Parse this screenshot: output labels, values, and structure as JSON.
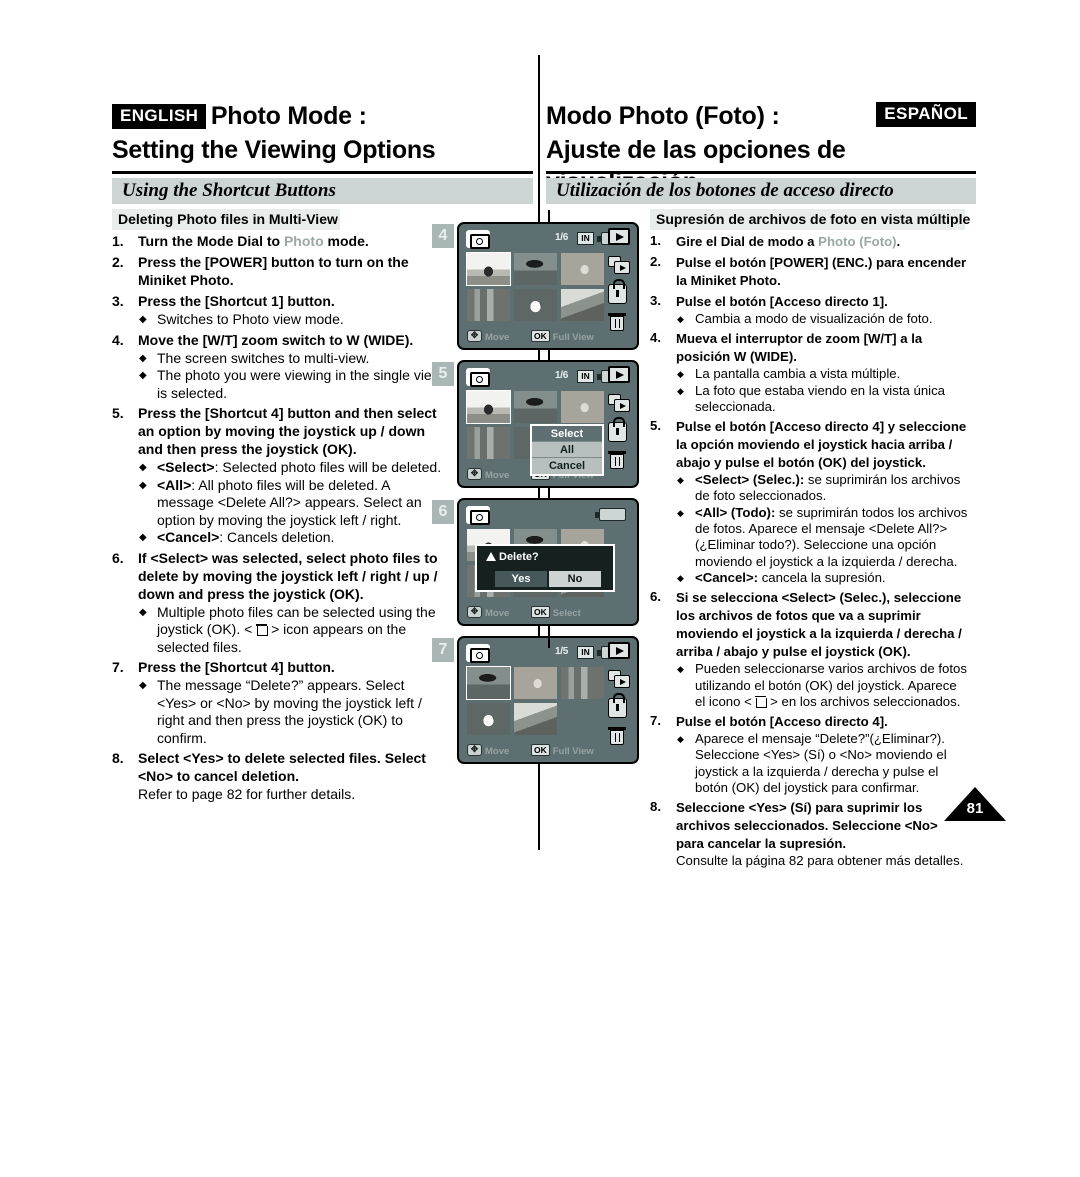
{
  "page": {
    "number": "81"
  },
  "header": {
    "english": {
      "lang_tag": "ENGLISH",
      "title_line1": "Photo Mode :",
      "title_line2": "Setting the Viewing Options",
      "banner": "Using the Shortcut Buttons",
      "subbanner": "Deleting Photo files in Multi-View"
    },
    "spanish": {
      "lang_tag": "ESPAÑOL",
      "title_line1": "Modo Photo (Foto) :",
      "title_line2": "Ajuste de las opciones de visualización",
      "banner": "Utilización de los botones de acceso directo",
      "subbanner": "Supresión de archivos de foto en vista múltiple"
    }
  },
  "english_steps": [
    {
      "num": "1.",
      "text_a": "Turn the Mode Dial to ",
      "gray": "Photo",
      "text_b": " mode.",
      "bullets": []
    },
    {
      "num": "2.",
      "text_a": "Press the [POWER] button to turn on the Miniket Photo.",
      "bullets": []
    },
    {
      "num": "3.",
      "text_a": "Press the [Shortcut 1] button.",
      "bullets": [
        "Switches to Photo view mode."
      ]
    },
    {
      "num": "4.",
      "text_a": "Move the [W/T] zoom switch to W (WIDE).",
      "bullets": [
        "The screen switches to multi-view.",
        "The photo you were viewing in the single view is selected."
      ]
    },
    {
      "num": "5.",
      "text_a": "Press the [Shortcut 4] button and then select an option by moving the joystick up / down and then press the joystick (OK).",
      "bullets": [],
      "rich_bullets": [
        {
          "strong": "<Select>",
          "rest": ": Selected photo files will be deleted."
        },
        {
          "strong": "<All>",
          "rest": ": All photo files will be deleted. A message <Delete All?> appears. Select an option by moving the joystick left / right."
        },
        {
          "strong": "<Cancel>",
          "rest": ": Cancels deletion."
        }
      ]
    },
    {
      "num": "6.",
      "text_a": "If <Select> was selected, select photo files to delete by moving the joystick left / right / up / down and press the joystick (OK).",
      "bullets": [],
      "trash_bullet": {
        "before": "Multiple photo files can be selected using the joystick (OK). < ",
        "after": " > icon appears on the selected files."
      }
    },
    {
      "num": "7.",
      "text_a": "Press the [Shortcut 4] button.",
      "bullets": [
        "The message “Delete?” appears. Select <Yes> or <No> by moving the joystick left / right and then press the joystick (OK) to confirm."
      ]
    },
    {
      "num": "8.",
      "text_a": "Select <Yes> to delete selected files. Select <No> to cancel deletion.",
      "bullets": [],
      "footnote": "Refer to page 82 for further details."
    }
  ],
  "spanish_steps": [
    {
      "num": "1.",
      "text_a": "Gire el Dial de modo a ",
      "gray": "Photo (Foto)",
      "text_b": ".",
      "bullets": []
    },
    {
      "num": "2.",
      "text_a": "Pulse el botón [POWER] (ENC.) para encender la Miniket Photo.",
      "bullets": []
    },
    {
      "num": "3.",
      "text_a": "Pulse el botón [Acceso directo 1].",
      "bullets": [
        "Cambia a modo de visualización de foto."
      ]
    },
    {
      "num": "4.",
      "text_a": "Mueva el interruptor de zoom [W/T] a la posición W (WIDE).",
      "bullets": [
        "La pantalla cambia a vista múltiple.",
        "La foto que estaba viendo en la vista única seleccionada."
      ]
    },
    {
      "num": "5.",
      "text_a": "Pulse el botón [Acceso directo 4] y seleccione la opción moviendo el joystick hacia arriba / abajo y pulse el botón (OK) del joystick.",
      "bullets": [],
      "rich_bullets": [
        {
          "strong": "<Select> (Selec.):",
          "rest": " se suprimirán los archivos de foto seleccionados."
        },
        {
          "strong": "<All> (Todo):",
          "rest": " se suprimirán todos los archivos de fotos. Aparece el mensaje <Delete All?> (¿Eliminar todo?). Seleccione una opción moviendo el joystick a la izquierda / derecha."
        },
        {
          "strong": "<Cancel>:",
          "rest": " cancela la supresión."
        }
      ]
    },
    {
      "num": "6.",
      "text_a": "Si se selecciona <Select> (Selec.), seleccione los archivos de fotos que va a suprimir moviendo el joystick a la izquierda / derecha / arriba / abajo y pulse el joystick (OK).",
      "bullets": [],
      "trash_bullet": {
        "before": "Pueden seleccionarse varios archivos de fotos utilizando el botón (OK) del joystick. Aparece el icono < ",
        "after": " > en los archivos seleccionados."
      }
    },
    {
      "num": "7.",
      "text_a": "Pulse el botón [Acceso directo 4].",
      "bullets": [
        "Aparece el mensaje “Delete?”(¿Eliminar?). Seleccione <Yes> (Sí) o <No> moviendo el joystick a la izquierda / derecha y pulse el botón (OK) del joystick para confirmar."
      ]
    },
    {
      "num": "8.",
      "text_a": "Seleccione <Yes> (Sí) para suprimir los archivos seleccionados. Seleccione <No> para cancelar la supresión.",
      "bullets": [],
      "footnote": "Consulte la página 82 para obtener más detalles."
    }
  ],
  "lcd_screens": [
    {
      "step_label": "4",
      "counter": "1/6",
      "memory_badge": "IN",
      "hint_move": "Move",
      "hint_ok_btn": "OK",
      "hint_ok_label": "Full View",
      "thumbs": [
        "kids",
        "palm",
        "rabbit",
        "city",
        "dog",
        "coast"
      ],
      "selected_index": 0,
      "rail_icons": [
        "play-icon",
        "multi-view-icon",
        "lock-icon",
        "trash-icon"
      ],
      "menu": null,
      "dialog": null
    },
    {
      "step_label": "5",
      "counter": "1/6",
      "memory_badge": "IN",
      "hint_move": "Move",
      "hint_ok_btn": "OK",
      "hint_ok_label": "Full View",
      "thumbs": [
        "kids",
        "palm",
        "rabbit",
        "city",
        "dog",
        "coast"
      ],
      "selected_index": 0,
      "rail_icons": [
        "play-icon",
        "multi-view-icon",
        "lock-icon",
        "trash-icon"
      ],
      "menu": {
        "items": [
          "Select",
          "All",
          "Cancel"
        ],
        "highlighted": 0
      },
      "dialog": null
    },
    {
      "step_label": "6",
      "counter": "",
      "memory_badge": "",
      "hint_move": "Move",
      "hint_ok_btn": "OK",
      "hint_ok_label": "Select",
      "thumbs": [
        "kids",
        "palm",
        "rabbit",
        "city",
        "dog",
        "coast"
      ],
      "selected_index": -1,
      "rail_icons": [],
      "menu": null,
      "dialog": {
        "title": "Delete?",
        "yes": "Yes",
        "no": "No",
        "highlighted": "Yes"
      }
    },
    {
      "step_label": "7",
      "counter": "1/5",
      "memory_badge": "IN",
      "hint_move": "Move",
      "hint_ok_btn": "OK",
      "hint_ok_label": "Full View",
      "thumbs": [
        "palm",
        "rabbit",
        "city",
        "dog",
        "coast"
      ],
      "selected_index": 0,
      "rail_icons": [
        "play-icon",
        "multi-view-icon",
        "lock-icon",
        "trash-icon"
      ],
      "menu": null,
      "dialog": null
    }
  ],
  "colors": {
    "banner_bg": "#ccd5d3",
    "subbanner_bg": "#e8ecea",
    "lcd_bg": "#5d6f70",
    "gray_word": "#9aa7a4",
    "step_box_bg": "#a8b7b5"
  }
}
